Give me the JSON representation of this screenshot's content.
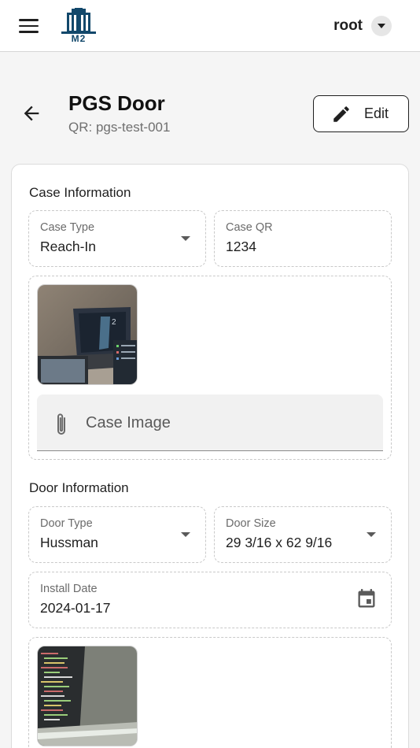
{
  "header": {
    "logo_text": "M2",
    "user_name": "root"
  },
  "page": {
    "title": "PGS Door",
    "subtitle": "QR: pgs-test-001",
    "edit_label": "Edit"
  },
  "case_info": {
    "title": "Case Information",
    "case_type_label": "Case Type",
    "case_type_value": "Reach-In",
    "case_qr_label": "Case QR",
    "case_qr_value": "1234",
    "case_image_label": "Case Image"
  },
  "door_info": {
    "title": "Door Information",
    "door_type_label": "Door Type",
    "door_type_value": "Hussman",
    "door_size_label": "Door Size",
    "door_size_value": "29 3/16 x 62 9/16",
    "install_date_label": "Install Date",
    "install_date_value": "2024-01-17"
  },
  "colors": {
    "logo": "#12486b",
    "text": "#1f1f1f",
    "muted": "#6b6b6b"
  }
}
